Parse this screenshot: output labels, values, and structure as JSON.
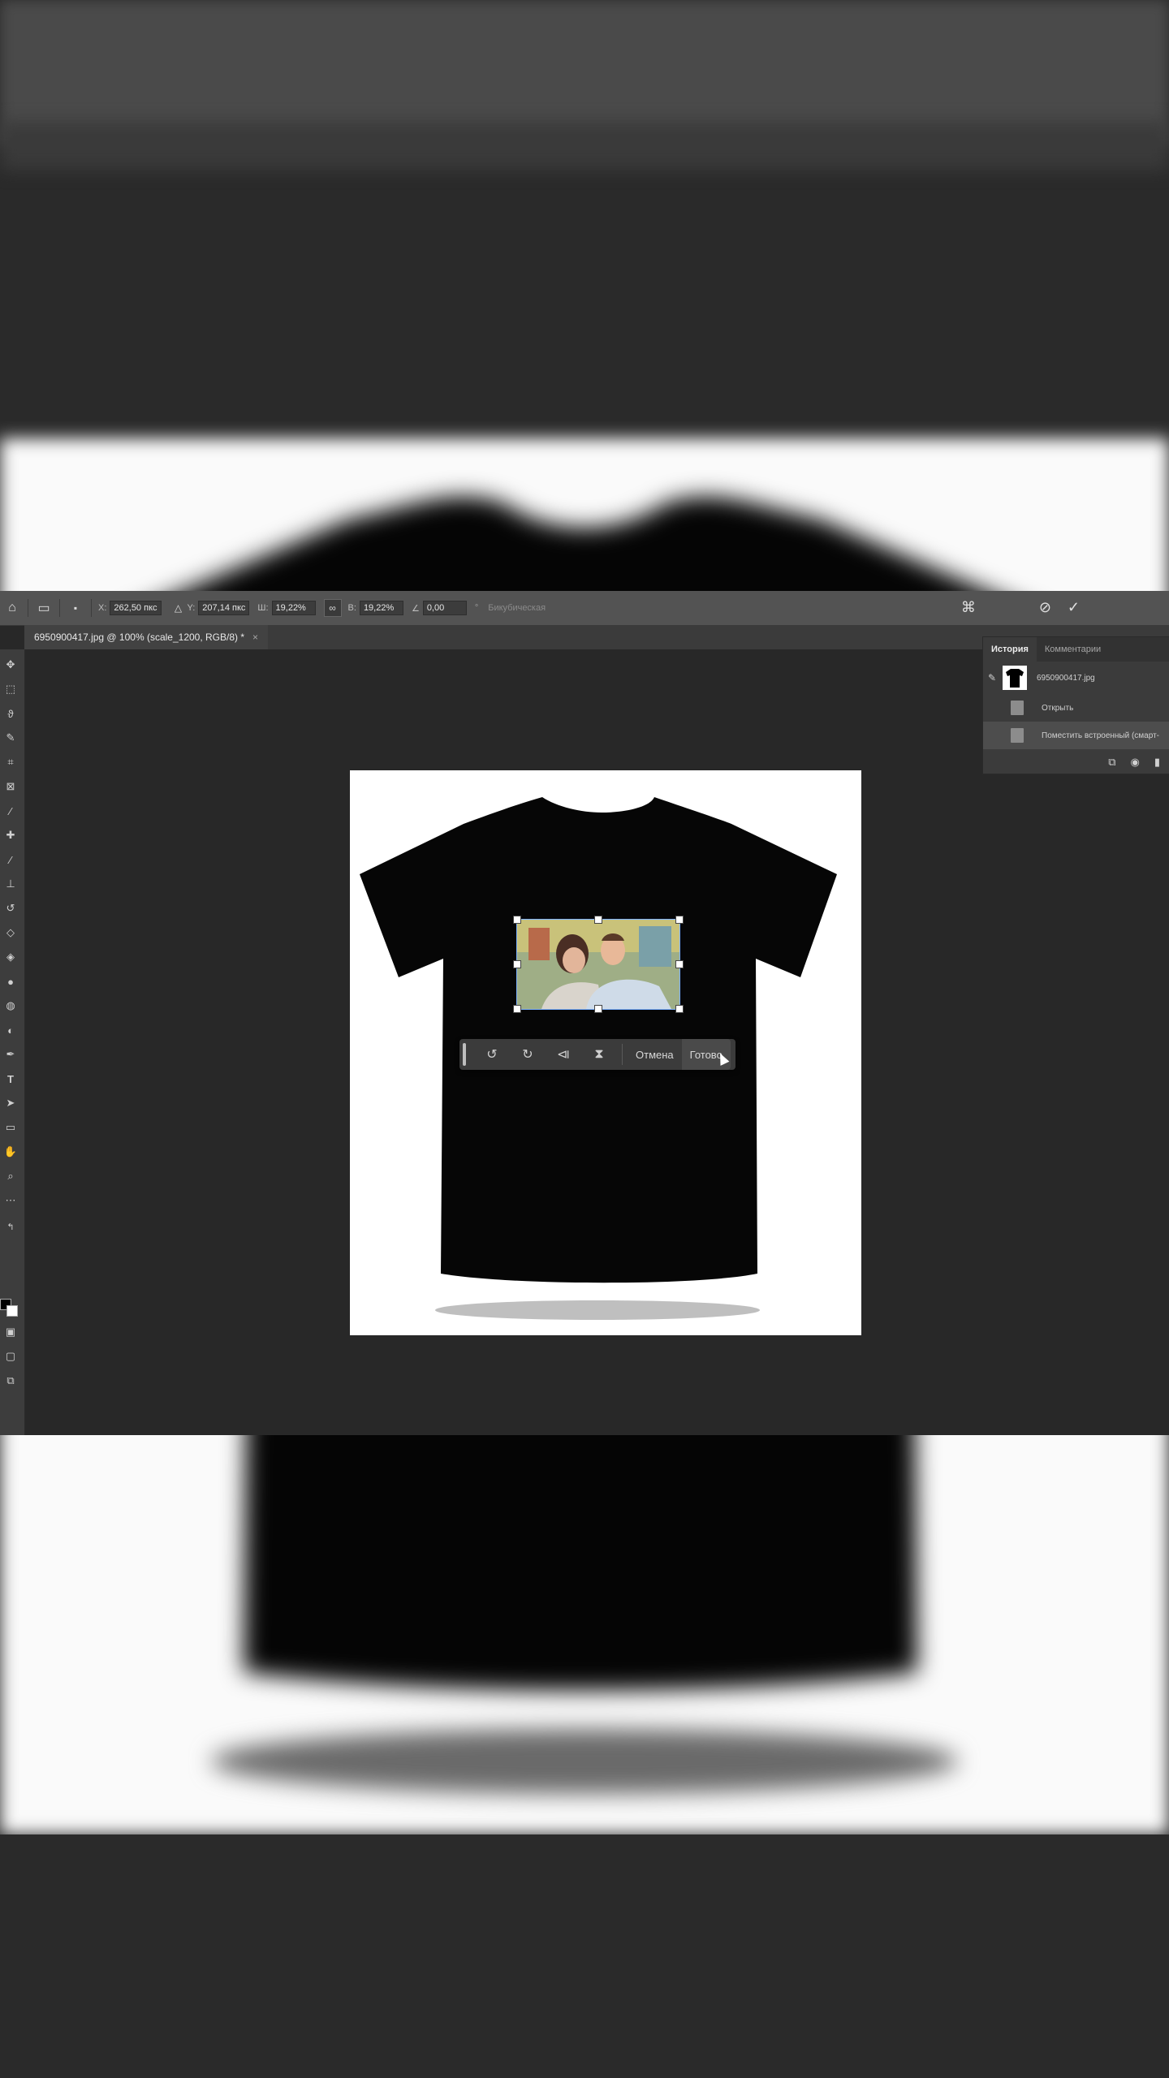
{
  "options_bar": {
    "x_label": "X:",
    "x_value": "262,50 пкс",
    "y_label": "Y:",
    "y_value": "207,14 пкс",
    "w_label": "Ш:",
    "w_value": "19,22%",
    "h_label": "В:",
    "h_value": "19,22%",
    "angle_value": "0,00",
    "interpolation": "Бикубическая"
  },
  "document_tab": {
    "title": "6950900417.jpg @ 100% (scale_1200, RGB/8) *",
    "close": "×"
  },
  "transform_toolbar": {
    "cancel_label": "Отмена",
    "done_label": "Готово"
  },
  "history_panel": {
    "tabs": [
      "История",
      "Комментарии"
    ],
    "snapshot_name": "6950900417.jpg",
    "steps": [
      "Открыть",
      "Поместить встроенный (смарт-"
    ]
  },
  "colors": {
    "app_bg": "#282828",
    "options_bar": "#535353",
    "panel": "#3b3b3b",
    "selection_handle": "#ffffff"
  }
}
